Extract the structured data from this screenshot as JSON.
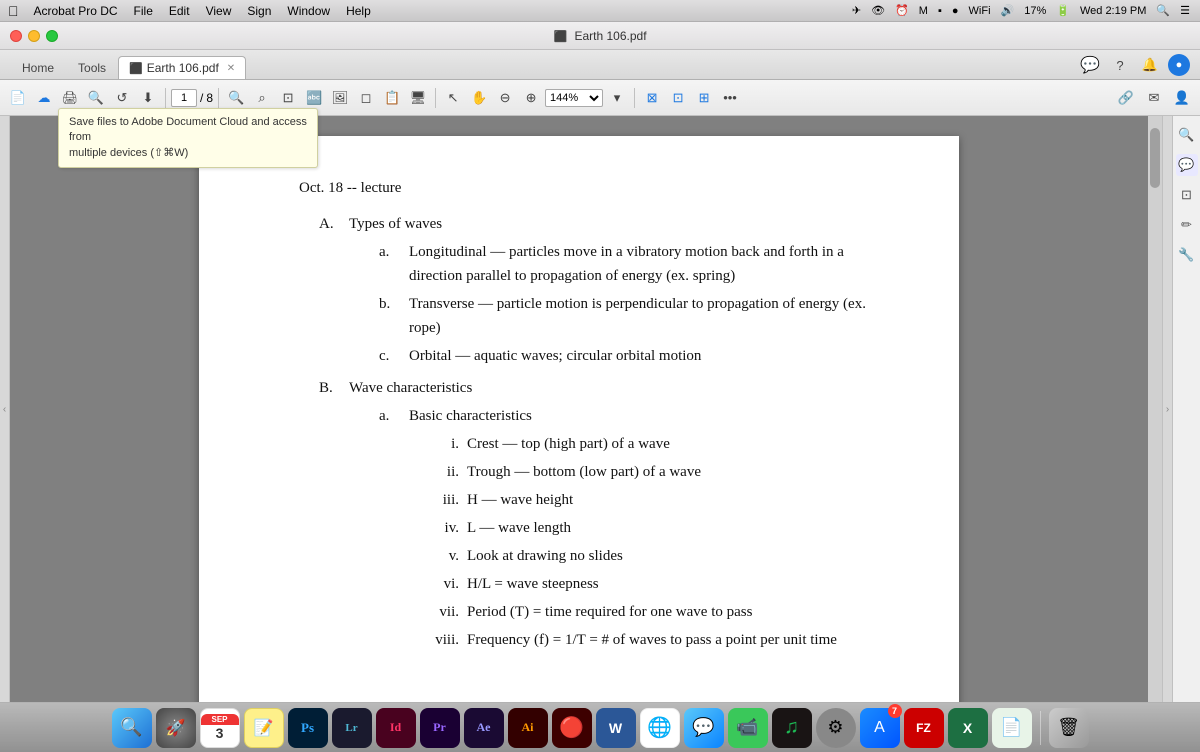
{
  "menubar": {
    "app_name": "Acrobat Pro DC",
    "menus": [
      "File",
      "Edit",
      "View",
      "Sign",
      "Window",
      "Help"
    ],
    "right": {
      "time": "Wed 2:19 PM",
      "battery": "17%",
      "wifi": "WiFi"
    }
  },
  "titlebar": {
    "title": "Earth 106.pdf"
  },
  "tabbar": {
    "home_label": "Home",
    "tools_label": "Tools",
    "doc_tab_label": "Earth 106.pdf"
  },
  "toolbar": {
    "page_current": "1",
    "page_total": "8",
    "zoom_level": "144%"
  },
  "tooltip": {
    "line1": "Save files to Adobe Document Cloud and access from",
    "line2": "multiple devices (⇧⌘W)"
  },
  "document": {
    "title": "Oct. 18 -- lecture",
    "section_a_label": "A.",
    "section_a_title": "Types of waves",
    "items": [
      {
        "label": "a.",
        "text": "Longitudinal — particles move in a vibratory motion back and forth in a direction parallel to propagation of energy (ex. spring)"
      },
      {
        "label": "b.",
        "text": "Transverse — particle motion is perpendicular to propagation of energy (ex. rope)"
      },
      {
        "label": "c.",
        "text": "Orbital — aquatic waves; circular orbital motion"
      }
    ],
    "section_b_label": "B.",
    "section_b_title": "Wave characteristics",
    "sub_items": [
      {
        "label": "a.",
        "title": "Basic characteristics",
        "roman_items": [
          {
            "num": "i.",
            "text": "Crest — top (high part) of a wave"
          },
          {
            "num": "ii.",
            "text": "Trough — bottom (low part) of a wave"
          },
          {
            "num": "iii.",
            "text": "H — wave height"
          },
          {
            "num": "iv.",
            "text": "L — wave length"
          },
          {
            "num": "v.",
            "text": "Look at drawing no slides"
          },
          {
            "num": "vi.",
            "text": "H/L = wave steepness"
          },
          {
            "num": "vii.",
            "text": "Period (T) = time required for one wave to pass"
          },
          {
            "num": "viii.",
            "text": "Frequency (f) = 1/T = # of waves to pass a point per unit time"
          }
        ]
      }
    ]
  },
  "dock": {
    "items": [
      {
        "name": "finder",
        "label": "🔍",
        "class": "icon-finder"
      },
      {
        "name": "launchpad",
        "label": "🚀",
        "class": "icon-launchpad"
      },
      {
        "name": "calendar",
        "label": "SEP\n3",
        "class": "icon-calendar"
      },
      {
        "name": "notes",
        "label": "📝",
        "class": "icon-notes"
      },
      {
        "name": "photoshop",
        "label": "Ps",
        "class": "icon-ps"
      },
      {
        "name": "lightroom",
        "label": "Lr",
        "class": "icon-lr"
      },
      {
        "name": "indesign",
        "label": "Id",
        "class": "icon-id"
      },
      {
        "name": "premiere",
        "label": "Pr",
        "class": "icon-pr"
      },
      {
        "name": "after-effects",
        "label": "Ae",
        "class": "icon-ae"
      },
      {
        "name": "illustrator",
        "label": "Ai",
        "class": "icon-ai"
      },
      {
        "name": "acrobat",
        "label": "🔴",
        "class": "icon-acrobat"
      },
      {
        "name": "word",
        "label": "W",
        "class": "icon-word"
      },
      {
        "name": "chrome",
        "label": "🌐",
        "class": "icon-chrome"
      },
      {
        "name": "messages",
        "label": "💬",
        "class": "icon-messages"
      },
      {
        "name": "facetime",
        "label": "📹",
        "class": "icon-facetime"
      },
      {
        "name": "spotify",
        "label": "♫",
        "class": "icon-spotify"
      },
      {
        "name": "settings",
        "label": "⚙",
        "class": "icon-settings"
      },
      {
        "name": "appstore",
        "label": "A",
        "class": "icon-appstore",
        "badge": "7"
      },
      {
        "name": "filezilla",
        "label": "FZ",
        "class": "icon-filezilla"
      },
      {
        "name": "excel",
        "label": "X",
        "class": "icon-excel"
      },
      {
        "name": "pages",
        "label": "📄",
        "class": "icon-pages"
      },
      {
        "name": "trash",
        "label": "🗑",
        "class": "icon-trash"
      }
    ]
  }
}
